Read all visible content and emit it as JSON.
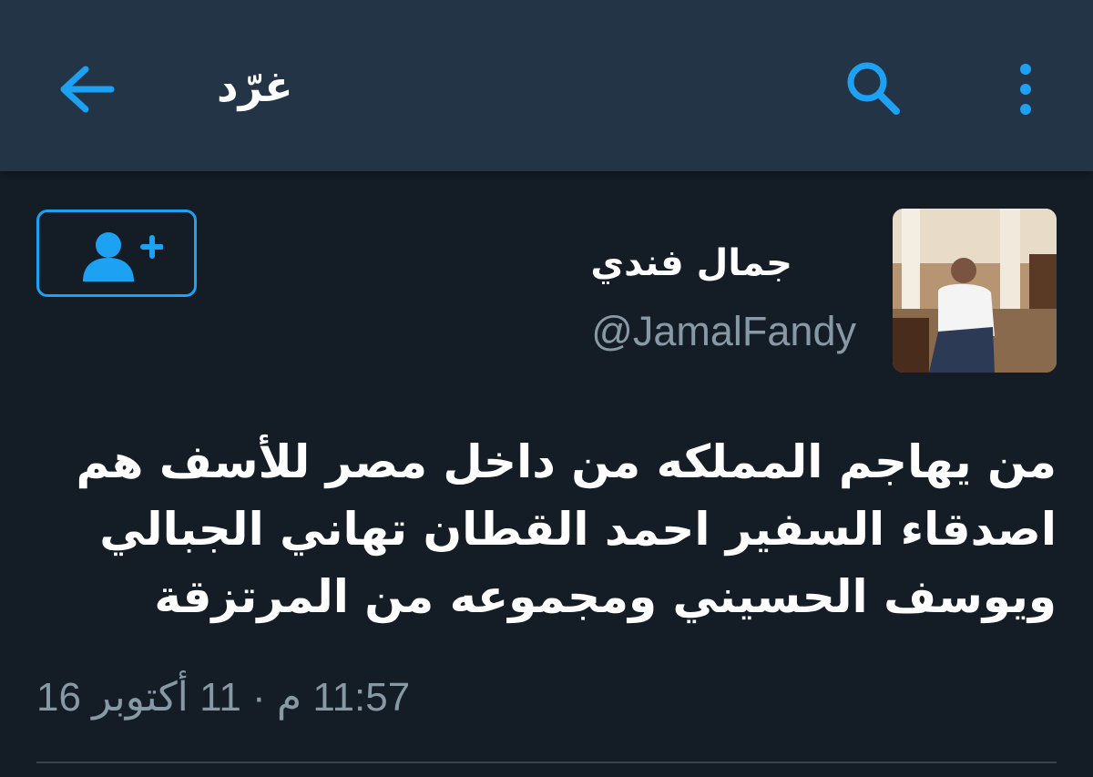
{
  "header": {
    "title": "غرّد",
    "back_icon": "arrow-left-icon",
    "search_icon": "search-icon",
    "more_icon": "more-vertical-icon",
    "accent_color": "#1da1f2"
  },
  "tweet": {
    "author": {
      "display_name": "جمال فندي",
      "handle": "@JamalFandy"
    },
    "follow_icon": "add-user-icon",
    "text_lines": [
      "من يهاجم المملكه من داخل مصر للأسف  هم",
      "اصدقاء السفير احمد القطان تهاني الجبالي",
      "ويوسف الحسيني ومجموعه من المرتزقة"
    ],
    "timestamp": "11:57 م · 11 أكتوبر 16"
  }
}
